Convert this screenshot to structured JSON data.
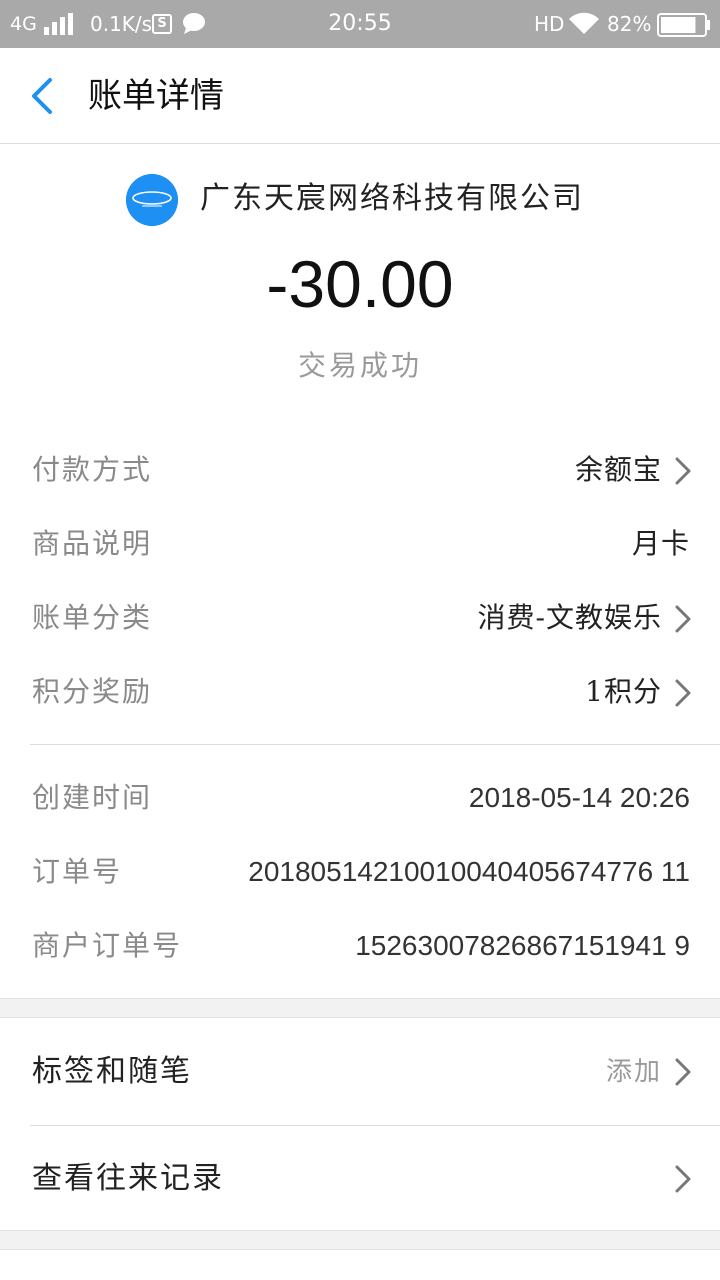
{
  "status_bar": {
    "network": "4G",
    "speed": "0.1K/s",
    "time": "20:55",
    "hd": "HD",
    "battery": "82%",
    "battery_level": 0.82
  },
  "header": {
    "title": "账单详情",
    "accent_color": "#1e8ff3"
  },
  "merchant": {
    "name": "广东天宸网络科技有限公司",
    "logo_color": "#1e8ff3"
  },
  "amount": "-30.00",
  "transaction_status": "交易成功",
  "details_group1": [
    {
      "label": "付款方式",
      "value": "余额宝",
      "has_arrow": true
    },
    {
      "label": "商品说明",
      "value": "月卡",
      "has_arrow": false
    },
    {
      "label": "账单分类",
      "value": "消费-文教娱乐",
      "has_arrow": true
    },
    {
      "label": "积分奖励",
      "value": "1积分",
      "has_arrow": true
    }
  ],
  "details_group2": [
    {
      "label": "创建时间",
      "value": "2018-05-14 20:26"
    },
    {
      "label": "订单号",
      "value": "20180514210010040405674776 11"
    },
    {
      "label": "商户订单号",
      "value": "15263007826867151941 9"
    }
  ],
  "actions": {
    "tags": {
      "label": "标签和随笔",
      "value": "添加"
    },
    "history": {
      "label": "查看往来记录"
    }
  }
}
